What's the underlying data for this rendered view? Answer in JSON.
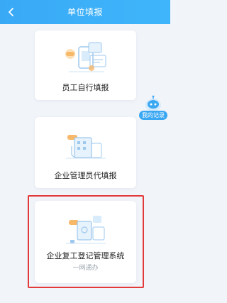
{
  "header": {
    "title": "单位填报"
  },
  "cards": [
    {
      "label": "员工自行填报"
    },
    {
      "label": "企业管理员代填报"
    },
    {
      "label": "企业复工登记管理系统",
      "sub": "一网通办"
    }
  ],
  "floating": {
    "label": "我的记录"
  },
  "colors": {
    "accent": "#39a9f6",
    "highlight": "#e23a3a"
  }
}
